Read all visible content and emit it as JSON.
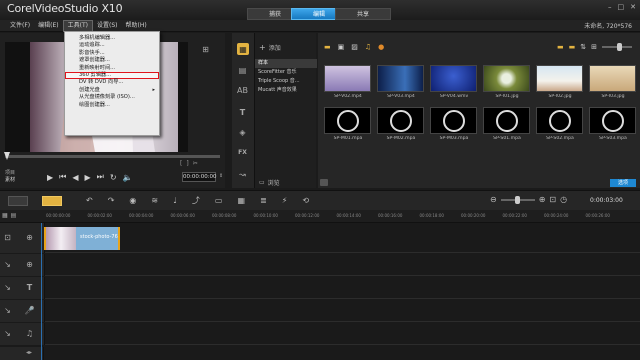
{
  "app": {
    "brand": "Corel",
    "product": "VideoStudio X10",
    "project_info": "未命名, 720*576"
  },
  "mode_tabs": [
    "捕获",
    "编辑",
    "共享"
  ],
  "menubar": [
    "文件(F)",
    "编辑(E)",
    "工具(T)",
    "设置(S)",
    "帮助(H)"
  ],
  "tools_menu": {
    "items": [
      {
        "label": "多相机编辑器..."
      },
      {
        "label": "运动追踪..."
      },
      {
        "label": "影音快手..."
      },
      {
        "label": "遮罩创建器..."
      },
      {
        "label": "重新映射时间..."
      },
      {
        "label": "360 剪辑器..."
      },
      {
        "label": "DV 转 DVD 向导..."
      },
      {
        "label": "创建光盘",
        "submenu": "▸"
      },
      {
        "label": "从光盘镜像刻录 (ISO)..."
      },
      {
        "label": "绘图创建器..."
      }
    ]
  },
  "player": {
    "mode_project": "项目",
    "mode_clip": "素材",
    "timecode": "00:00:00:00"
  },
  "library": {
    "add_label": "添加",
    "browse_label": "浏览",
    "folders": [
      "样本",
      "ScoreFitter 音乐",
      "Triple Scoop 音...",
      "Mucatt 声音效果"
    ],
    "media_row1": [
      "SP-V02.mp4",
      "SP-V03.mp4",
      "SP-V04.wmv",
      "SP-I01.jpg",
      "SP-I02.jpg",
      "SP-I03.jpg"
    ],
    "media_row2": [
      "SP-M01.mpa",
      "SP-M02.mpa",
      "SP-M03.mpa",
      "SP-S01.mpa",
      "SP-S02.mpa",
      "SP-S03.mpa"
    ],
    "options_label": "选项"
  },
  "timeline": {
    "timecode": "0:00:03:00",
    "ruler_ticks": [
      "00:00:00:00",
      "00:00:02:00",
      "00:00:04:00",
      "00:00:06:00",
      "00:00:08:00",
      "00:00:10:00",
      "00:00:12:00",
      "00:00:14:00",
      "00:00:16:00",
      "00:00:18:00",
      "00:00:20:00",
      "00:00:22:00",
      "00:00:24:00",
      "00:00:26:00"
    ],
    "clip_label": "stock-photo-76"
  },
  "colors": {
    "accent": "#1e88d2",
    "highlight_box": "#e0141c",
    "clip": "#7fb0d6",
    "clip_edge": "#e8a41a"
  }
}
